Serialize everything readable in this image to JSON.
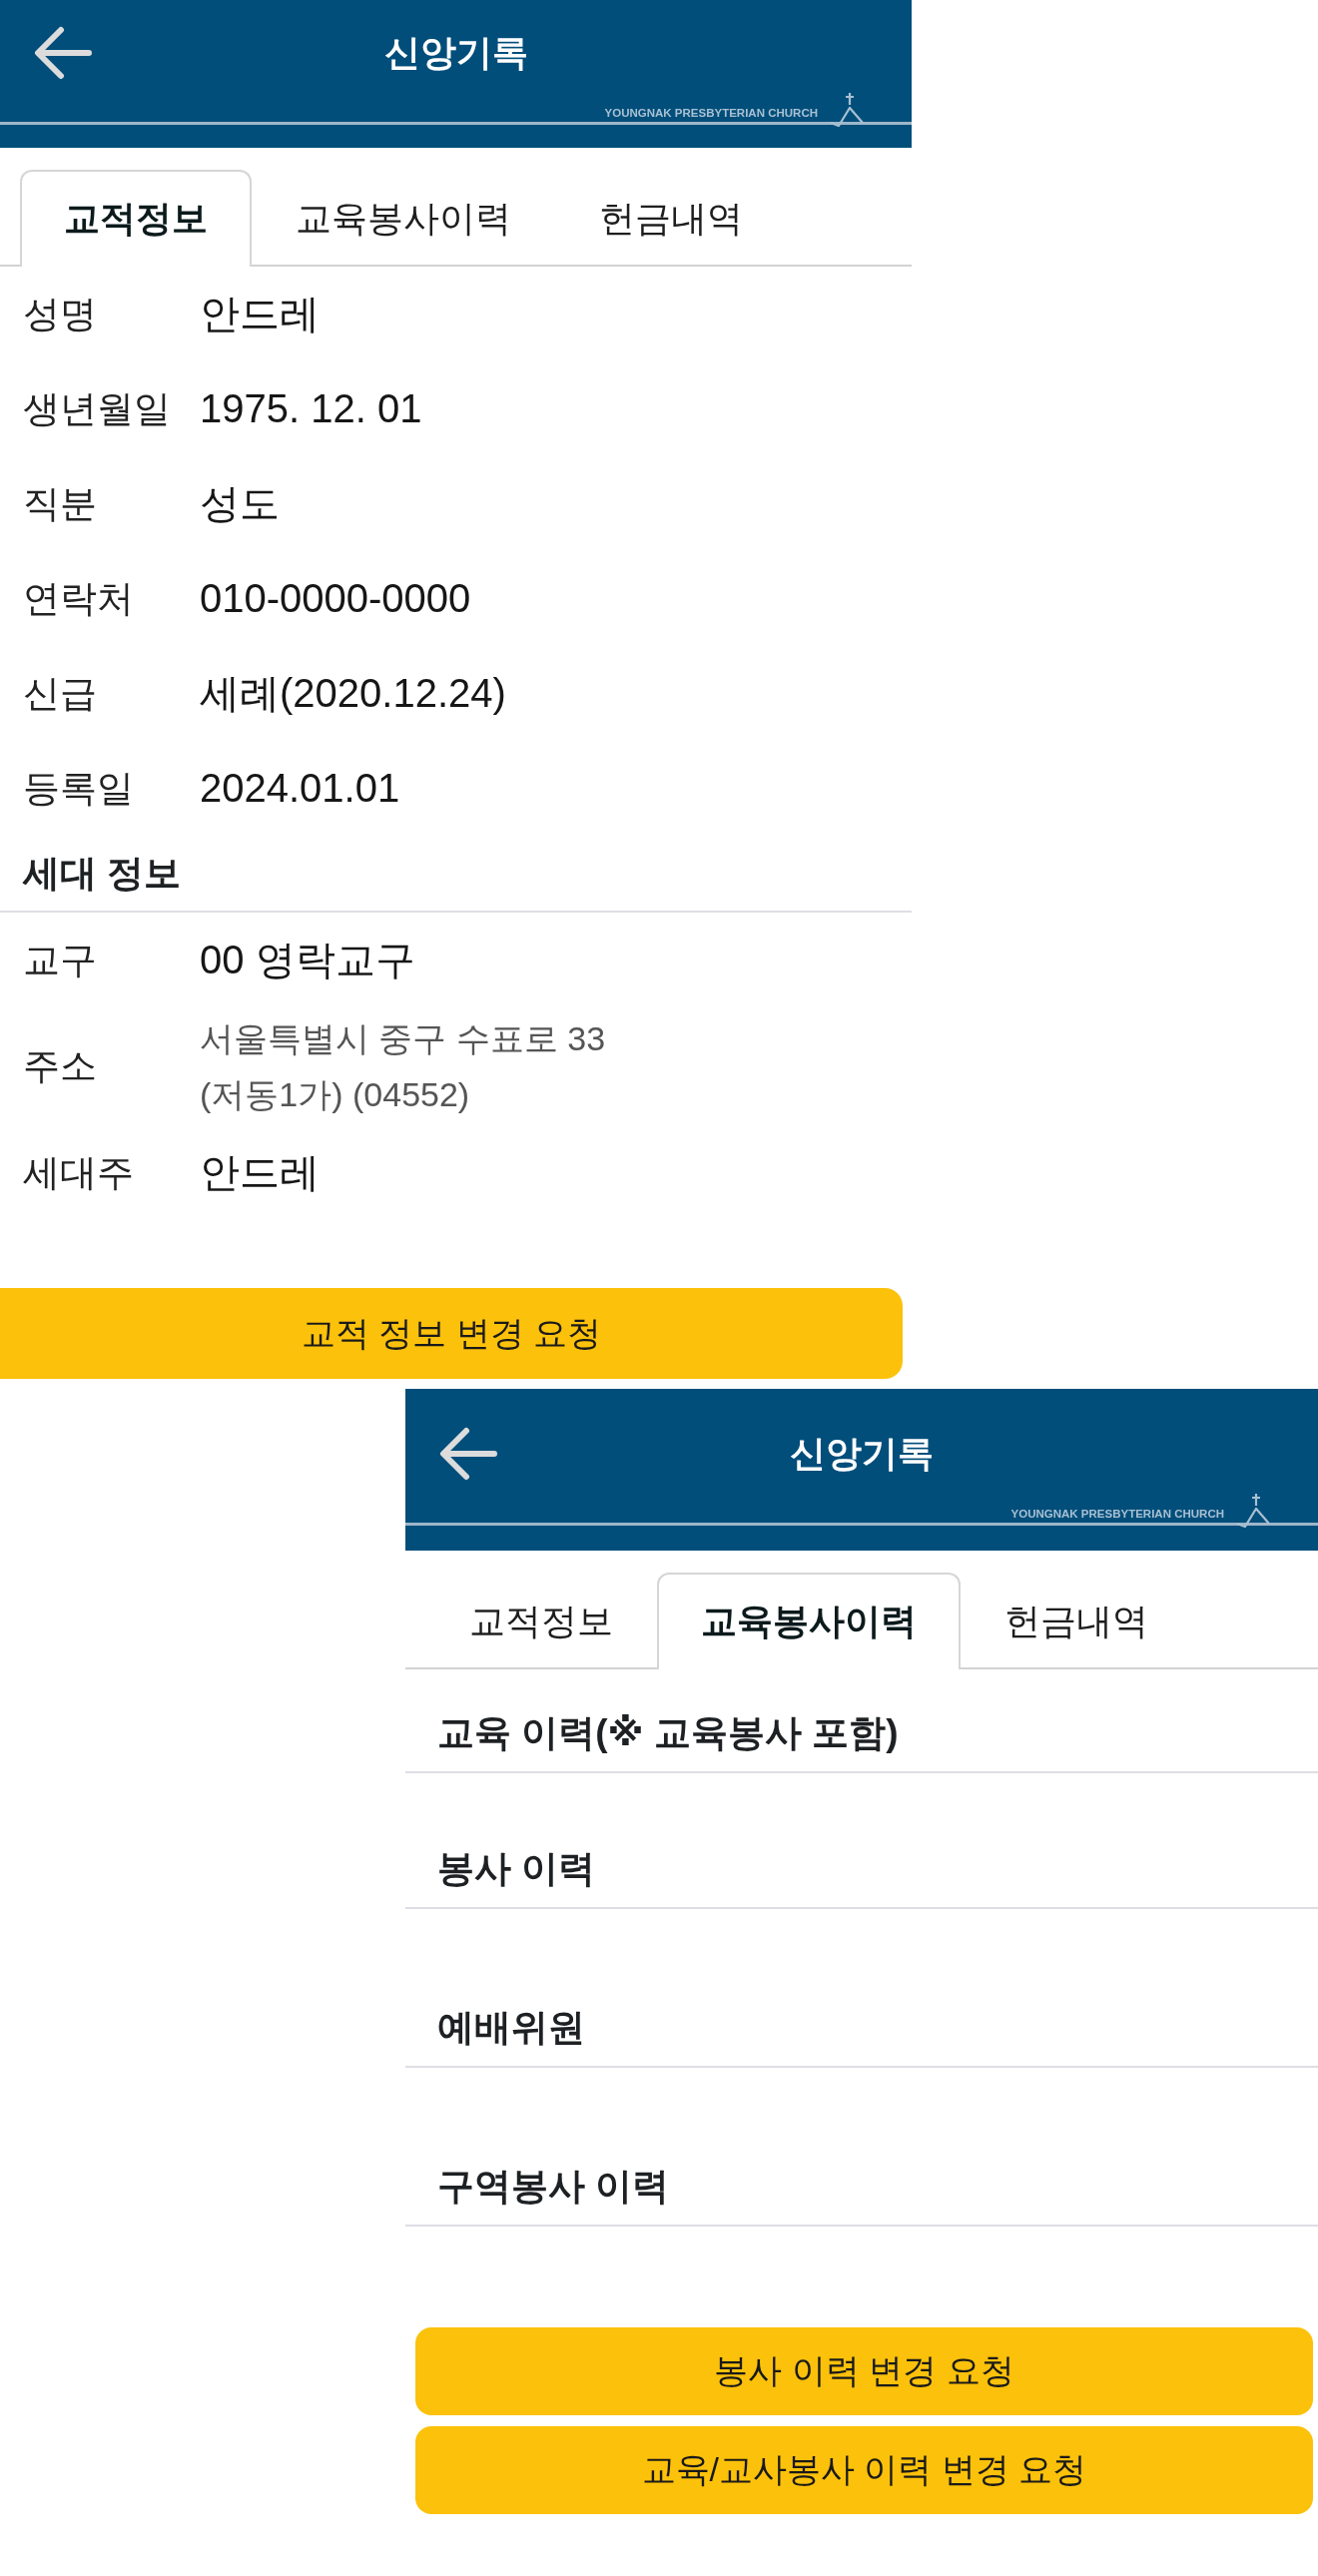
{
  "screens": [
    {
      "header": {
        "title": "신앙기록",
        "wordmark": "YOUNGNAK PRESBYTERIAN CHURCH"
      },
      "tabs": [
        {
          "label": "교적정보",
          "selected": true
        },
        {
          "label": "교육봉사이력",
          "selected": false
        },
        {
          "label": "헌금내역",
          "selected": false
        }
      ],
      "content": [
        {
          "kind": "field",
          "label": "성명",
          "value": "안드레"
        },
        {
          "kind": "field",
          "label": "생년월일",
          "value": "1975. 12. 01"
        },
        {
          "kind": "field",
          "label": "직분",
          "value": "성도"
        },
        {
          "kind": "field",
          "label": "연락처",
          "value": "010-0000-0000"
        },
        {
          "kind": "field",
          "label": "신급",
          "value": "세례(2020.12.24)"
        },
        {
          "kind": "field",
          "label": "등록일",
          "value": "2024.01.01"
        },
        {
          "kind": "heading",
          "title": "세대 정보"
        },
        {
          "kind": "field",
          "label": "교구",
          "value": "00 영락교구"
        },
        {
          "kind": "address",
          "label": "주소",
          "lines": [
            "서울특별시 중구 수표로 33",
            "(저동1가) (04552)"
          ]
        },
        {
          "kind": "field",
          "label": "세대주",
          "value": "안드레"
        }
      ],
      "buttons": [
        "교적 정보 변경 요청"
      ]
    },
    {
      "header": {
        "title": "신앙기록",
        "wordmark": "YOUNGNAK PRESBYTERIAN CHURCH"
      },
      "tabs": [
        {
          "label": "교적정보",
          "selected": false
        },
        {
          "label": "교육봉사이력",
          "selected": true
        },
        {
          "label": "헌금내역",
          "selected": false
        }
      ],
      "content": [
        {
          "kind": "section",
          "title": "교육 이력(※ 교육봉사 포함)"
        },
        {
          "kind": "section",
          "title": "봉사 이력"
        },
        {
          "kind": "section",
          "title": "예배위원"
        },
        {
          "kind": "section",
          "title": "구역봉사 이력"
        }
      ],
      "buttons": [
        "봉사 이력 변경 요청",
        "교육/교사봉사 이력 변경 요청"
      ]
    }
  ]
}
